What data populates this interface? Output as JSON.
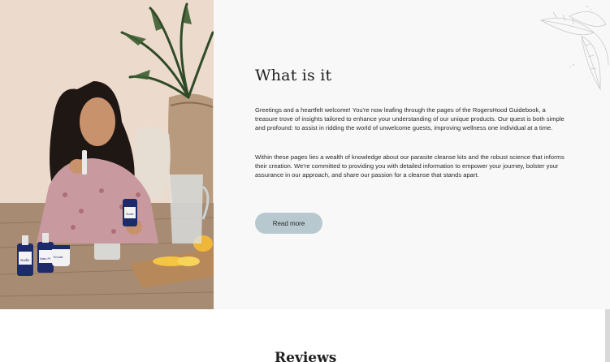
{
  "about": {
    "heading": "What is it",
    "paragraph_1": "Greetings and a heartfelt welcome! You're now leafing through the pages of the RogersHood Guidebook, a treasure trove of insights tailored to enhance your understanding of our unique products. Our quest is both simple and profound: to assist in ridding the world of unwelcome guests, improving wellness one individual at a time.",
    "paragraph_2": "Within these pages lies a wealth of knowledge about our parasite cleanse kits and the robust science that informs their creation. We're committed to providing you with detailed information to empower your journey, bolster your assurance in our approach, and share our passion for a cleanse that stands apart.",
    "read_more_label": "Read more"
  },
  "photo": {
    "bottle_labels": [
      "Sodix",
      "Natu Pr",
      "Emulsi",
      "Sodix"
    ]
  },
  "reviews": {
    "title": "Reviews"
  },
  "colors": {
    "content_bg": "#f8f8f8",
    "button_bg": "#b8c8cf",
    "text": "#2a2a2a"
  }
}
